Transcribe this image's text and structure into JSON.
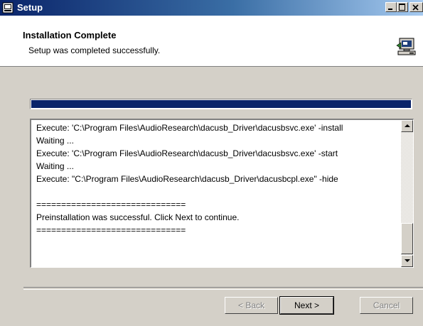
{
  "window": {
    "title": "Setup"
  },
  "header": {
    "title": "Installation Complete",
    "subtitle": "Setup was completed successfully.",
    "icon": "computer-installer-icon"
  },
  "progress": {
    "value": 1.0
  },
  "log": {
    "lines": [
      "Execute:  'C:\\Program Files\\AudioResearch\\dacusb_Driver\\dacusbsvc.exe' -install",
      "Waiting ...",
      "Execute:  'C:\\Program Files\\AudioResearch\\dacusb_Driver\\dacusbsvc.exe' -start",
      "Waiting ...",
      "Execute:  \"C:\\Program Files\\AudioResearch\\dacusb_Driver\\dacusbcpl.exe\" -hide",
      "",
      "==============================",
      "Preinstallation was successful. Click Next to continue.",
      "=============================="
    ]
  },
  "buttons": {
    "back": "< Back",
    "next": "Next >",
    "cancel": "Cancel"
  },
  "colors": {
    "titlebar_start": "#0a246a",
    "titlebar_end": "#a6caf0",
    "progress_fill": "#0a246a",
    "face": "#d4d0c8"
  }
}
